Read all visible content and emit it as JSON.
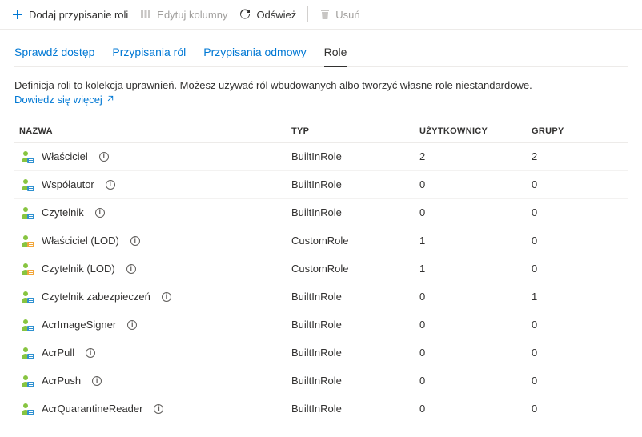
{
  "toolbar": {
    "add_label": "Dodaj przypisanie roli",
    "edit_columns_label": "Edytuj kolumny",
    "refresh_label": "Odśwież",
    "delete_label": "Usuń"
  },
  "tabs": {
    "items": [
      {
        "label": "Sprawdź dostęp",
        "active": false
      },
      {
        "label": "Przypisania ról",
        "active": false
      },
      {
        "label": "Przypisania odmowy",
        "active": false
      },
      {
        "label": "Role",
        "active": true
      }
    ]
  },
  "description_text": "Definicja roli to kolekcja uprawnień. Możesz używać ról wbudowanych albo tworzyć własne role niestandardowe.",
  "learn_more_label": "Dowiedz się więcej",
  "columns": {
    "name": "Nazwa",
    "type": "Typ",
    "users": "Użytkownicy",
    "groups": "Grupy"
  },
  "rows": [
    {
      "name": "Właściciel",
      "type": "BuiltInRole",
      "users": "2",
      "groups": "2",
      "kind": "builtin"
    },
    {
      "name": "Współautor",
      "type": "BuiltInRole",
      "users": "0",
      "groups": "0",
      "kind": "builtin"
    },
    {
      "name": "Czytelnik",
      "type": "BuiltInRole",
      "users": "0",
      "groups": "0",
      "kind": "builtin"
    },
    {
      "name": "Właściciel (LOD)",
      "type": "CustomRole",
      "users": "1",
      "groups": "0",
      "kind": "custom"
    },
    {
      "name": "Czytelnik (LOD)",
      "type": "CustomRole",
      "users": "1",
      "groups": "0",
      "kind": "custom"
    },
    {
      "name": "Czytelnik zabezpieczeń",
      "type": "BuiltInRole",
      "users": "0",
      "groups": "1",
      "kind": "builtin"
    },
    {
      "name": "AcrImageSigner",
      "type": "BuiltInRole",
      "users": "0",
      "groups": "0",
      "kind": "builtin"
    },
    {
      "name": "AcrPull",
      "type": "BuiltInRole",
      "users": "0",
      "groups": "0",
      "kind": "builtin"
    },
    {
      "name": "AcrPush",
      "type": "BuiltInRole",
      "users": "0",
      "groups": "0",
      "kind": "builtin"
    },
    {
      "name": "AcrQuarantineReader",
      "type": "BuiltInRole",
      "users": "0",
      "groups": "0",
      "kind": "builtin"
    }
  ],
  "colors": {
    "accent": "#0078d4",
    "icon_green": "#87c440",
    "icon_blue": "#2f91d0",
    "icon_orange": "#f2a63a"
  }
}
